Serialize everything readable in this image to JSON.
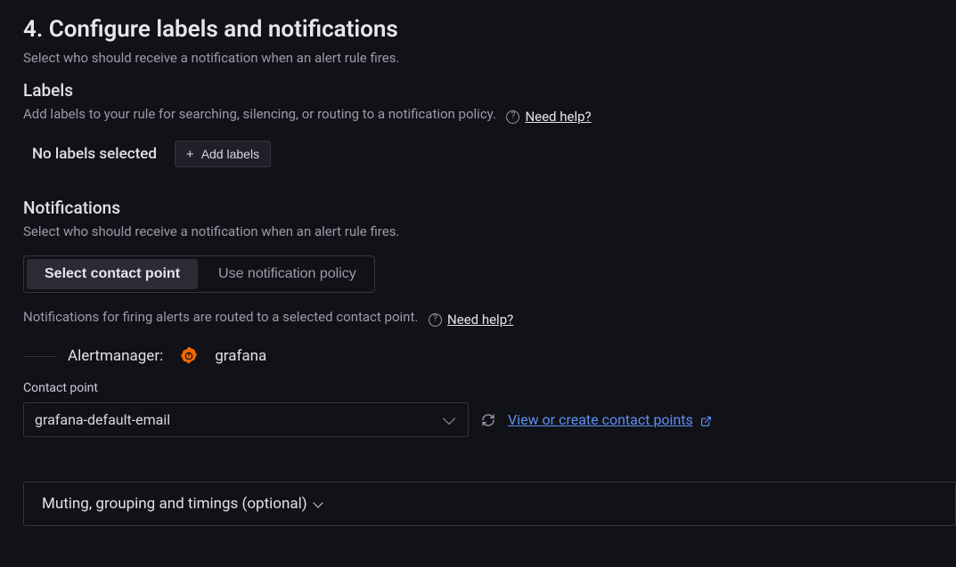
{
  "section": {
    "title": "4. Configure labels and notifications",
    "description": "Select who should receive a notification when an alert rule fires."
  },
  "labels": {
    "heading": "Labels",
    "description": "Add labels to your rule for searching, silencing, or routing to a notification policy.",
    "help_text": "Need help?",
    "empty_text": "No labels selected",
    "add_button": "Add labels"
  },
  "notifications": {
    "heading": "Notifications",
    "description": "Select who should receive a notification when an alert rule fires.",
    "toggle": {
      "option_a": "Select contact point",
      "option_b": "Use notification policy",
      "active": "a"
    },
    "routed_text": "Notifications for firing alerts are routed to a selected contact point.",
    "help_text": "Need help?"
  },
  "alertmanager": {
    "label": "Alertmanager:",
    "name": "grafana"
  },
  "contact_point": {
    "label": "Contact point",
    "selected": "grafana-default-email",
    "link_text": "View or create contact points"
  },
  "collapse": {
    "title": "Muting, grouping and timings (optional)"
  }
}
